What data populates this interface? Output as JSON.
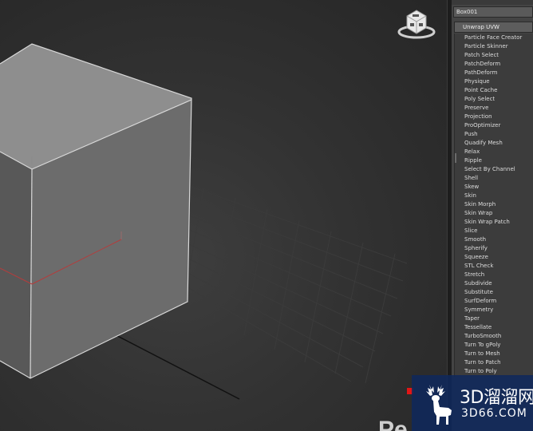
{
  "viewport": {
    "partial_label": "Pe"
  },
  "command_panel": {
    "object_name": "Box001",
    "modifier_dropdown": "Unwrap UVW",
    "modifier_list": [
      "Particle Face Creator",
      "Particle Skinner",
      "Patch Select",
      "PatchDeform",
      "PathDeform",
      "Physique",
      "Point Cache",
      "Poly Select",
      "Preserve",
      "Projection",
      "ProOptimizer",
      "Push",
      "Quadify Mesh",
      "Relax",
      "Ripple",
      "Select By Channel",
      "Shell",
      "Skew",
      "Skin",
      "Skin Morph",
      "Skin Wrap",
      "Skin Wrap Patch",
      "Slice",
      "Smooth",
      "Spherify",
      "Squeeze",
      "STL Check",
      "Stretch",
      "Subdivide",
      "Substitute",
      "SurfDeform",
      "Symmetry",
      "Taper",
      "Tessellate",
      "TurboSmooth",
      "Turn To gPoly",
      "Turn to Mesh",
      "Turn to Patch",
      "Turn to Poly"
    ]
  },
  "watermark": {
    "brand": "3D溜溜网",
    "url": "3D66.COM"
  },
  "colors": {
    "viewport_bg": "#323232",
    "cube_top": "#8d8d8d",
    "cube_front": "#6d6d6d",
    "cube_edge": "#d8d8d8",
    "x_axis": "#b43c3c",
    "panel_bg": "#444444",
    "list_bg": "#3c3c3c",
    "watermark_bg": "#0e285c",
    "record_red": "#e21616"
  }
}
